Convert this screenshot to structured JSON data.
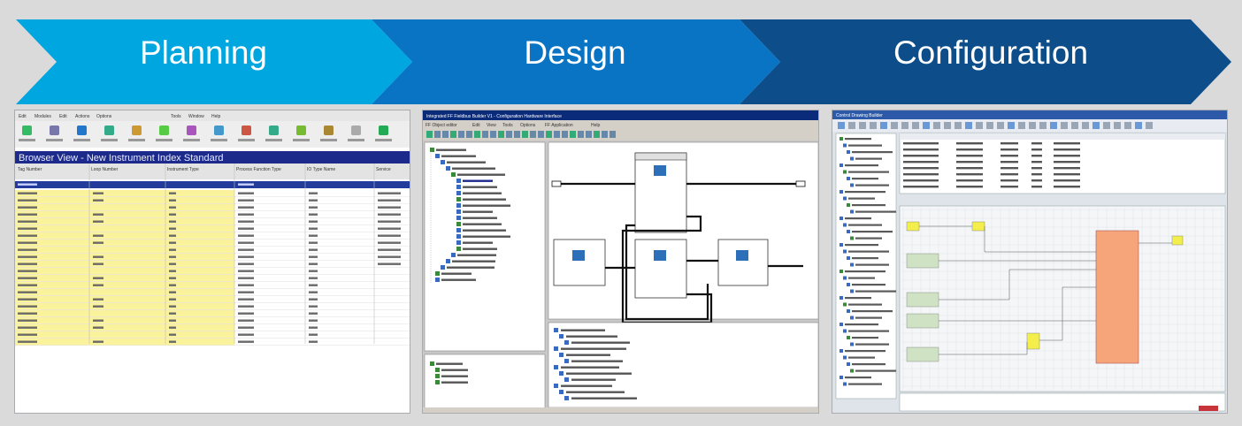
{
  "banner": {
    "colors": {
      "stage1": "#00a6e0",
      "stage2": "#0a74c4",
      "stage3": "#0d4e8a"
    },
    "stages": [
      {
        "label": "Planning"
      },
      {
        "label": "Design"
      },
      {
        "label": "Configuration"
      }
    ]
  },
  "planning_window": {
    "menu": [
      "Edit",
      "Modules",
      "Edit",
      "Actions",
      "Options",
      "Tools",
      "Window",
      "Help"
    ],
    "toolbar_icons": [
      "new-icon",
      "key-reports-icon",
      "browse-icon",
      "index-icon",
      "open-icon",
      "wiring-icon",
      "new-item-icon",
      "schedule-icon",
      "cross-ref-icon",
      "workflow-icon",
      "calibration-icon",
      "maintenance-icon",
      "check-icon",
      "new-index-icon"
    ],
    "title": "Browser View - New Instrument Index Standard",
    "columns": [
      "Tag Number",
      "Loop Number",
      "Instrument Type",
      "Process Function Type",
      "IO Type Name",
      "Service"
    ]
  },
  "design_window": {
    "title": "Integrated FF Fieldbus Builder V1 - Configuration Hardware Interface",
    "menu": [
      "FF Object editor",
      "Edit",
      "View",
      "Tools",
      "Options",
      "FF Application",
      "Help"
    ]
  },
  "configuration_window": {
    "title": "Control Drawing Builder"
  }
}
